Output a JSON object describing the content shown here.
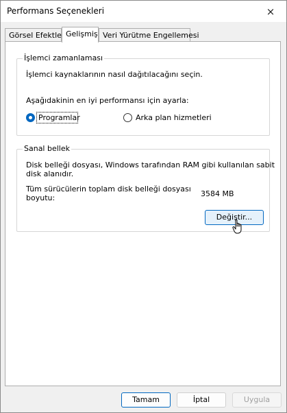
{
  "window": {
    "title": "Performans Seçenekleri",
    "close_icon": "×"
  },
  "tabs": [
    {
      "label": "Görsel Efektler",
      "active": false
    },
    {
      "label": "Gelişmiş",
      "active": true
    },
    {
      "label": "Veri Yürütme Engellemesi",
      "active": false
    }
  ],
  "cpu": {
    "legend": "İşlemci zamanlaması",
    "desc": "İşlemci kaynaklarının nasıl dağıtılacağını seçin.",
    "prompt": "Aşağıdakinin en iyi performansı için ayarla:",
    "options": [
      {
        "label": "Programlar",
        "checked": true
      },
      {
        "label": "Arka plan hizmetleri",
        "checked": false
      }
    ]
  },
  "vm": {
    "legend": "Sanal bellek",
    "desc_line1": "Disk belleği dosyası, Windows tarafından RAM gibi kullanılan sabit",
    "desc_line2": "disk alanıdır.",
    "total_line1": "Tüm sürücülerin toplam disk belleği dosyası",
    "total_line2": "boyutu:",
    "total_value": "3584 MB",
    "change_button": "Değiştir..."
  },
  "footer": {
    "ok": "Tamam",
    "cancel": "İptal",
    "apply": "Uygula",
    "apply_enabled": false
  },
  "colors": {
    "accent": "#0067c0"
  }
}
